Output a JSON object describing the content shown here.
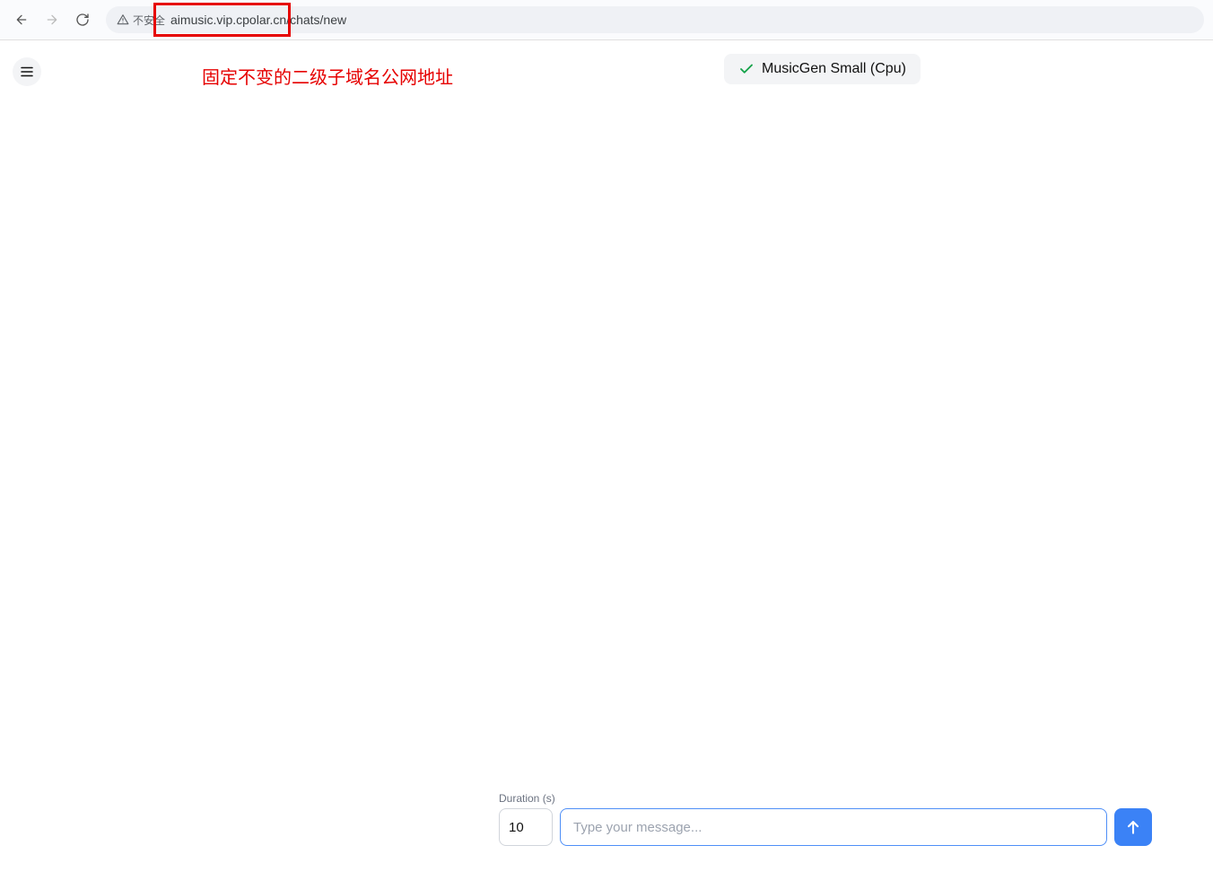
{
  "browser": {
    "security_text": "不安全",
    "url": "aimusic.vip.cpolar.cn/chats/new"
  },
  "annotation": {
    "text": "固定不变的二级子域名公网地址"
  },
  "header": {
    "model_badge": "MusicGen Small (Cpu)"
  },
  "bottom": {
    "duration_label": "Duration (s)",
    "duration_value": "10",
    "message_placeholder": "Type your message..."
  }
}
